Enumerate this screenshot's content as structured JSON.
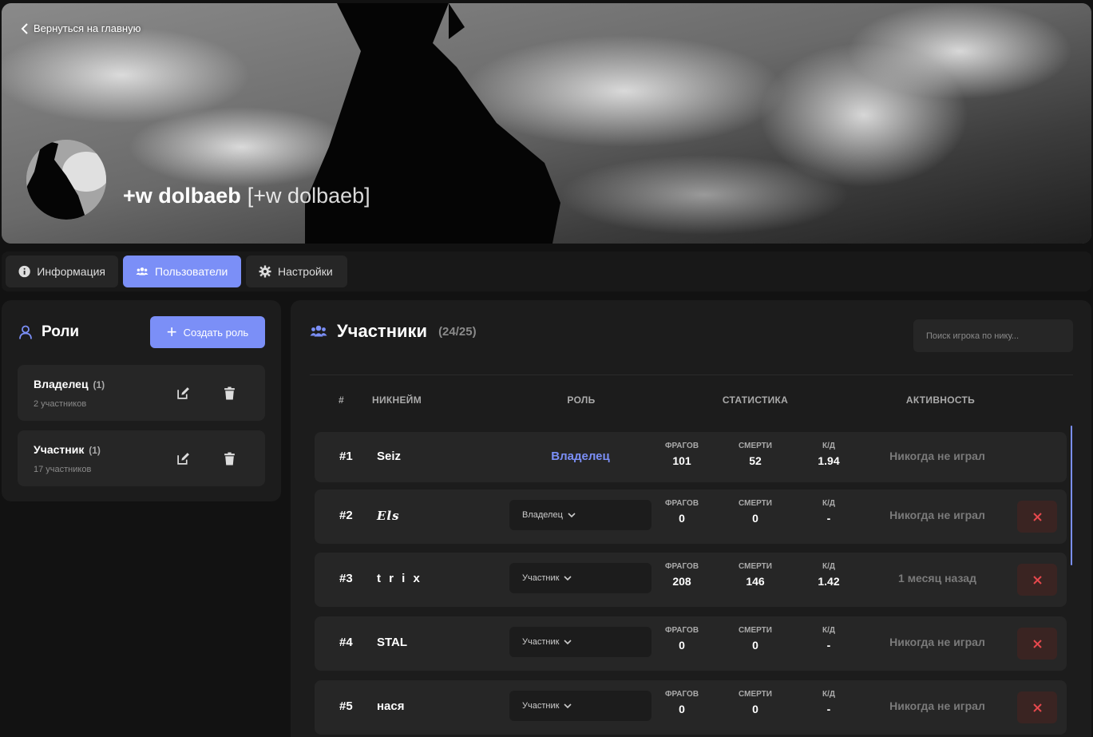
{
  "banner": {
    "back_label": "Вернуться на главную",
    "clan_name": "+w dolbaeb",
    "clan_tag": "[+w dolbaeb]"
  },
  "tabs": [
    {
      "label": "Информация",
      "icon": "info-icon",
      "active": false
    },
    {
      "label": "Пользователи",
      "icon": "users-icon",
      "active": true
    },
    {
      "label": "Настройки",
      "icon": "gear-icon",
      "active": false
    }
  ],
  "roles": {
    "title": "Роли",
    "create_label": "Создать роль",
    "items": [
      {
        "name": "Владелец",
        "count": "(1)",
        "members": "2 участников"
      },
      {
        "name": "Участник",
        "count": "(1)",
        "members": "17 участников"
      }
    ]
  },
  "members": {
    "title": "Участники",
    "count": "(24/25)",
    "search_placeholder": "Поиск игрока по нику...",
    "columns": {
      "rank": "#",
      "nick": "НИКНЕЙМ",
      "role": "РОЛЬ",
      "stats": "СТАТИСТИКА",
      "activity": "АКТИВНОСТЬ"
    },
    "stat_labels": {
      "frags": "ФРАГОВ",
      "deaths": "СМЕРТИ",
      "kd": "К/Д"
    },
    "rows": [
      {
        "rank": "#1",
        "nick": "Seiz",
        "role": "Владелец",
        "role_editable": false,
        "frags": "101",
        "deaths": "52",
        "kd": "1.94",
        "activity": "Никогда не играл"
      },
      {
        "rank": "#2",
        "nick": "𝑬𝒍𝒔",
        "role": "Владелец",
        "role_editable": true,
        "frags": "0",
        "deaths": "0",
        "kd": "-",
        "activity": "Никогда не играл"
      },
      {
        "rank": "#3",
        "nick": "t r i x",
        "role": "Участник",
        "role_editable": true,
        "frags": "208",
        "deaths": "146",
        "kd": "1.42",
        "activity": "1 месяц назад"
      },
      {
        "rank": "#4",
        "nick": "STAL",
        "role": "Участник",
        "role_editable": true,
        "frags": "0",
        "deaths": "0",
        "kd": "-",
        "activity": "Никогда не играл"
      },
      {
        "rank": "#5",
        "nick": "нася",
        "role": "Участник",
        "role_editable": true,
        "frags": "0",
        "deaths": "0",
        "kd": "-",
        "activity": "Никогда не играл"
      }
    ]
  },
  "colors": {
    "accent": "#7b8ff7",
    "danger": "#e5484d",
    "panel": "#1c1c1c",
    "card": "#262626"
  }
}
